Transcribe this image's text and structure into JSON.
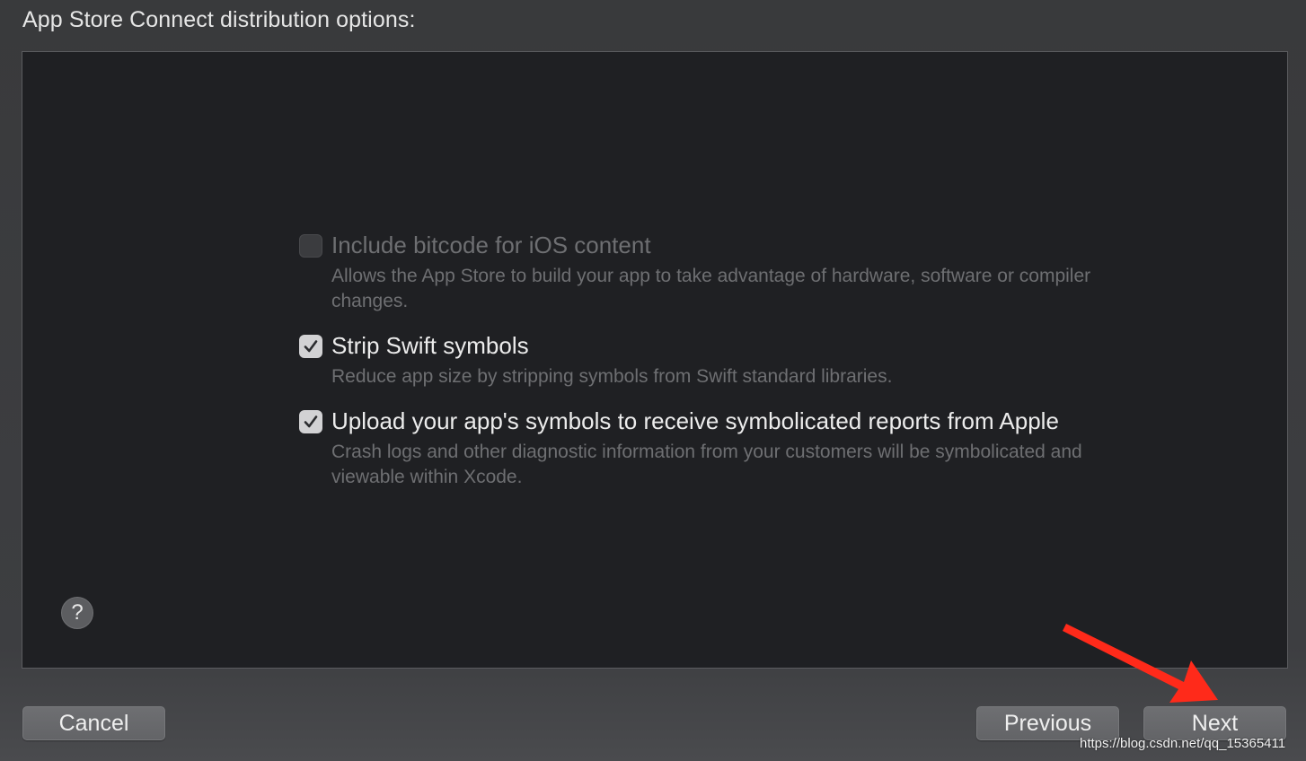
{
  "sheet": {
    "heading": "App Store Connect distribution options:"
  },
  "options": [
    {
      "title": "Include bitcode for iOS content",
      "description": "Allows the App Store to build your app to take advantage of hardware, software or compiler changes.",
      "checked": false,
      "enabled": false
    },
    {
      "title": "Strip Swift symbols",
      "description": "Reduce app size by stripping symbols from Swift standard libraries.",
      "checked": true,
      "enabled": true
    },
    {
      "title": "Upload your app's symbols to receive symbolicated reports from Apple",
      "description": "Crash logs and other diagnostic information from your customers will be symbolicated and viewable within Xcode.",
      "checked": true,
      "enabled": true
    }
  ],
  "help": {
    "label": "?",
    "icon": "question-mark-icon"
  },
  "buttons": {
    "cancel": "Cancel",
    "previous": "Previous",
    "next": "Next"
  },
  "annotation": {
    "arrow_color": "#ff2a1a",
    "icon": "red-arrow-icon"
  },
  "watermark": "https://blog.csdn.net/qq_15365411"
}
